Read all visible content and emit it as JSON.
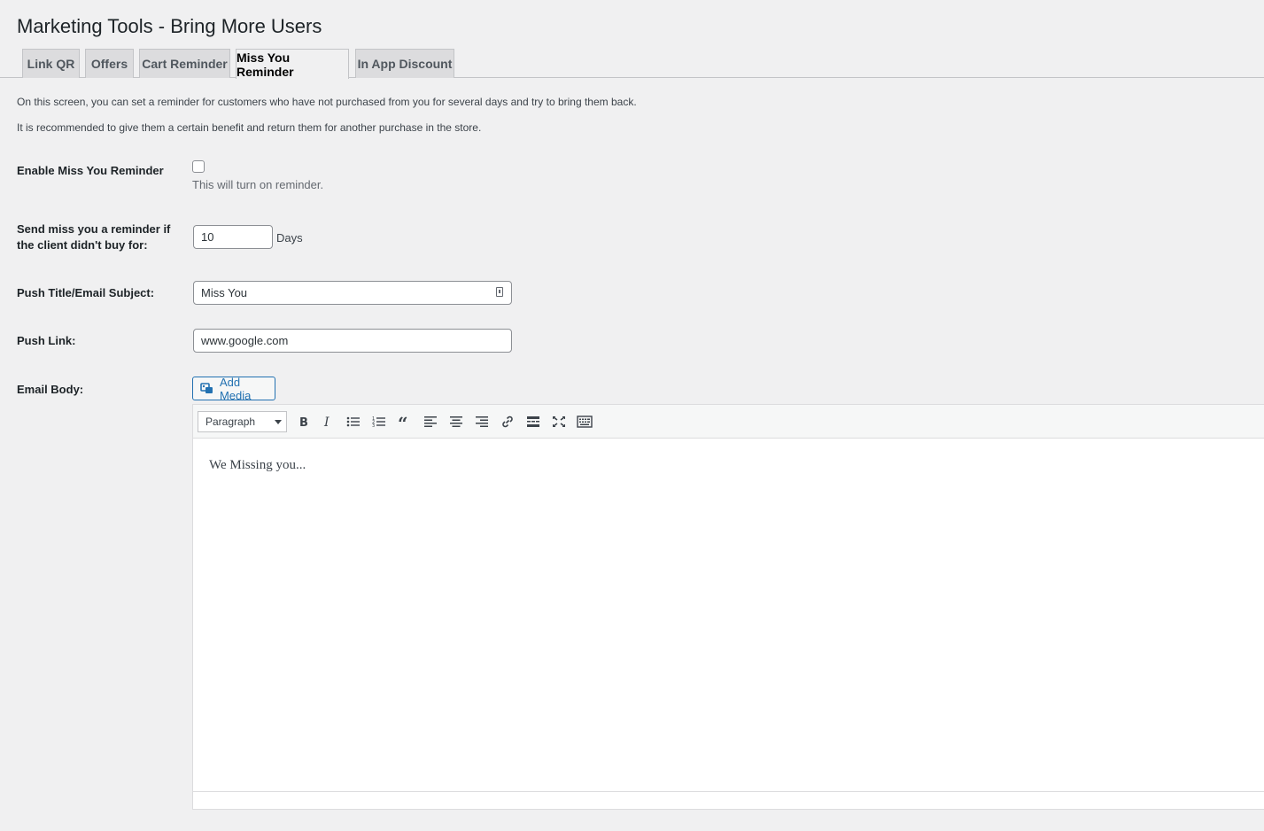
{
  "header": {
    "title": "Marketing Tools - Bring More Users"
  },
  "tabs": [
    {
      "label": "Link QR"
    },
    {
      "label": "Offers"
    },
    {
      "label": "Cart Reminder"
    },
    {
      "label": "Miss You Reminder",
      "active": true
    },
    {
      "label": "In App Discount"
    }
  ],
  "description": {
    "line1": "On this screen, you can set a reminder for customers who have not purchased from you for several days and try to bring them back.",
    "line2": "It is recommended to give them a certain benefit and return them for another purchase in the store."
  },
  "form": {
    "enable": {
      "label": "Enable Miss You Reminder",
      "checked": false,
      "help": "This will turn on reminder."
    },
    "days": {
      "label": "Send miss you a reminder if the client didn't buy for:",
      "value": "10",
      "unit": "Days"
    },
    "push_title": {
      "label": "Push Title/Email Subject:",
      "value": "Miss You"
    },
    "push_link": {
      "label": "Push Link:",
      "value": "www.google.com"
    },
    "email_body": {
      "label": "Email Body:"
    }
  },
  "editor": {
    "add_media_label": "Add Media",
    "format_select": "Paragraph",
    "toolbar_icons": [
      "bold-icon",
      "italic-icon",
      "bullet-list-icon",
      "numbered-list-icon",
      "blockquote-icon",
      "align-left-icon",
      "align-center-icon",
      "align-right-icon",
      "link-icon",
      "read-more-icon",
      "fullscreen-icon",
      "toolbar-toggle-icon"
    ],
    "content": "We Missing you..."
  },
  "colors": {
    "accent": "#2271b1",
    "background": "#f0f0f1",
    "tab_inactive": "#dcdcde"
  }
}
